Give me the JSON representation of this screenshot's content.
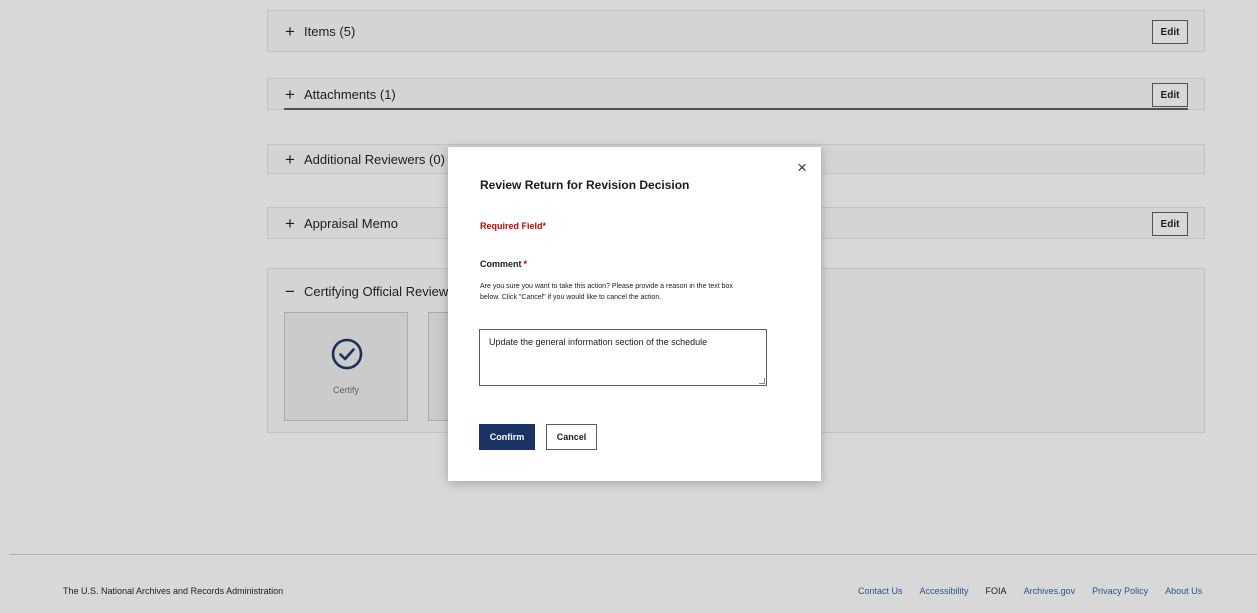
{
  "panels": {
    "items": {
      "toggle": "+",
      "label": "Items (5)",
      "edit_label": "Edit"
    },
    "attachments": {
      "toggle": "+",
      "label": "Attachments (1)",
      "edit_label": "Edit"
    },
    "reviewers": {
      "toggle": "+",
      "label": "Additional Reviewers (0)"
    },
    "memo": {
      "toggle": "+",
      "label": "Appraisal Memo",
      "edit_label": "Edit"
    },
    "certifying": {
      "toggle": "−",
      "label": "Certifying Official Review",
      "tiles": [
        {
          "label": "Certify",
          "icon": "check-circle-icon"
        }
      ]
    }
  },
  "modal": {
    "title": "Review Return for Revision Decision",
    "required_note": "Required Field*",
    "comment_label": "Comment",
    "comment_required_mark": "*",
    "help_text": "Are you sure you want to take this action? Please provide a reason in the text box below. Click \"Cancel\" if you would like to cancel the action.",
    "comment_value": "Update the general information section of the schedule",
    "confirm_label": "Confirm",
    "cancel_label": "Cancel",
    "close_icon": "×"
  },
  "footer": {
    "org": "The U.S. National Archives and Records Administration",
    "links": [
      "Contact Us",
      "Accessibility",
      "FOIA",
      "Archives.gov",
      "Privacy Policy",
      "About Us"
    ]
  },
  "colors": {
    "primary": "#1a3365",
    "required": "#b50909",
    "link": "#2a5db0"
  }
}
